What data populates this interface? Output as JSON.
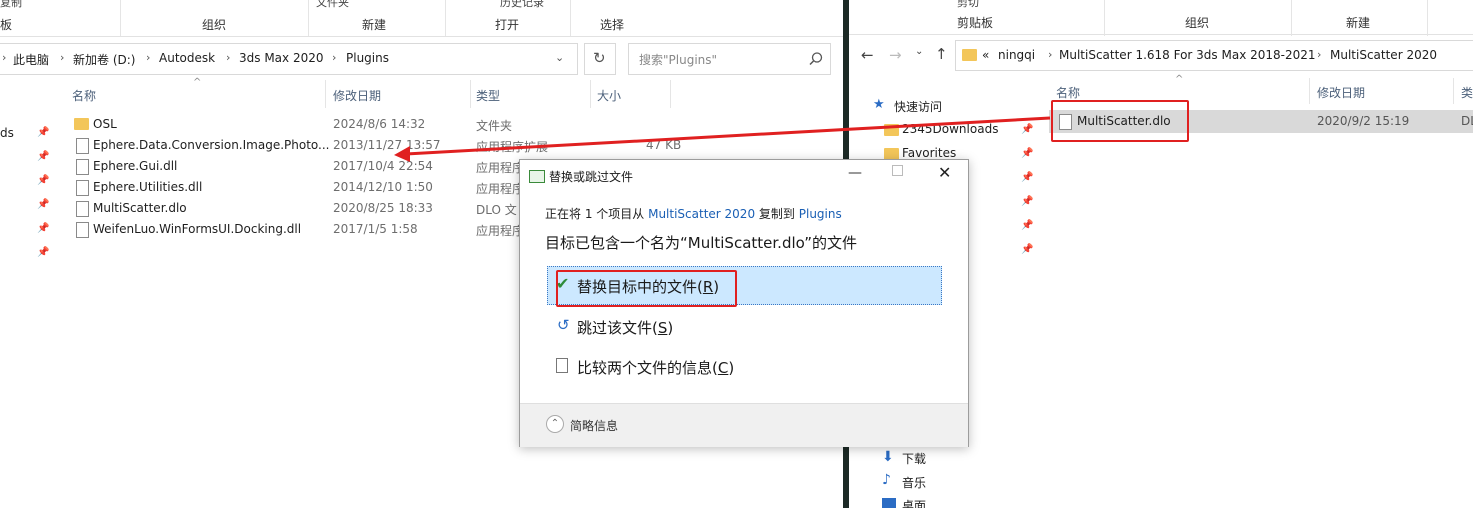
{
  "left_window": {
    "ribbon": {
      "top_items": [
        "复制",
        "文件夹",
        "历史记录"
      ],
      "groups": [
        "板",
        "组织",
        "新建",
        "打开",
        "选择"
      ]
    },
    "breadcrumb": [
      "此电脑",
      "新加卷 (D:)",
      "Autodesk",
      "3ds Max 2020",
      "Plugins"
    ],
    "search_placeholder": "搜索\"Plugins\"",
    "nav_partial": "ds",
    "columns": {
      "name": "名称",
      "date": "修改日期",
      "type": "类型",
      "size": "大小"
    },
    "files": [
      {
        "name": "OSL",
        "date": "2024/8/6 14:32",
        "type": "文件夹",
        "size": "",
        "kind": "folder"
      },
      {
        "name": "Ephere.Data.Conversion.Image.Photo...",
        "date": "2013/11/27 13:57",
        "type": "应用程序扩展",
        "size": "47 KB",
        "kind": "dll"
      },
      {
        "name": "Ephere.Gui.dll",
        "date": "2017/10/4 22:54",
        "type": "应用程序",
        "size": "",
        "kind": "dll"
      },
      {
        "name": "Ephere.Utilities.dll",
        "date": "2014/12/10 1:50",
        "type": "应用程序",
        "size": "",
        "kind": "dll"
      },
      {
        "name": "MultiScatter.dlo",
        "date": "2020/8/25 18:33",
        "type": "DLO 文",
        "size": "",
        "kind": "file"
      },
      {
        "name": "WeifenLuo.WinFormsUI.Docking.dll",
        "date": "2017/1/5 1:58",
        "type": "应用程序",
        "size": "",
        "kind": "dll"
      }
    ]
  },
  "right_window": {
    "ribbon": {
      "top_items": [
        "剪切"
      ],
      "groups": [
        "剪贴板",
        "组织",
        "新建"
      ]
    },
    "breadcrumb": [
      "«",
      "ningqi",
      "MultiScatter 1.618 For 3ds Max 2018-2021",
      "MultiScatter 2020"
    ],
    "columns": {
      "name": "名称",
      "date": "修改日期",
      "type": "类"
    },
    "files": [
      {
        "name": "MultiScatter.dlo",
        "date": "2020/9/2 15:19",
        "type": "DL"
      }
    ],
    "nav": {
      "quick_access": "快速访问",
      "items": [
        "2345Downloads",
        "Favorites",
        "下载",
        "音乐",
        "桌面"
      ]
    }
  },
  "dialog": {
    "title": "替换或跳过文件",
    "progress_prefix": "正在将 1 个项目从",
    "source": "MultiScatter 2020",
    "progress_mid": "复制到",
    "dest": "Plugins",
    "message": "目标已包含一个名为“MultiScatter.dlo”的文件",
    "option_replace": "替换目标中的文件(",
    "option_replace_key": "R",
    "option_skip": "跳过该文件(",
    "option_skip_key": "S",
    "option_compare": "比较两个文件的信息(",
    "option_compare_key": "C",
    "close_paren": ")",
    "details": "简略信息"
  },
  "colors": {
    "highlight": "#cce8ff",
    "annotation_red": "#e02020",
    "link_blue": "#1a5fb4",
    "accent_check": "#2e8b3a"
  }
}
